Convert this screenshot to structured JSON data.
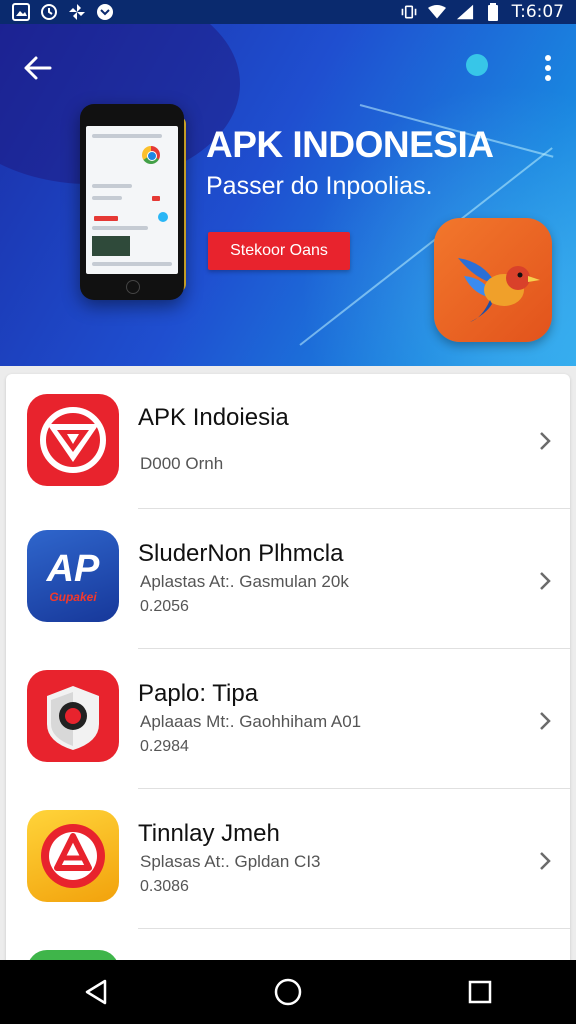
{
  "status_bar": {
    "time": "T:6:07",
    "left_icons": [
      "image-icon",
      "sync-icon",
      "pinwheel-icon",
      "chevron-circle-icon"
    ],
    "right_icons": [
      "vibrate-icon",
      "wifi-icon",
      "signal-icon",
      "battery-icon"
    ]
  },
  "banner": {
    "title": "APK INDONESIA",
    "subtitle": "Passer do Inpoolias.",
    "button_label": "Stekoor Oans",
    "colors": {
      "start": "#1a2fa8",
      "end": "#2aa6ec",
      "button": "#e8232d",
      "app_icon": "#f2772c"
    }
  },
  "apps": [
    {
      "name": "APK Indoiesia",
      "subtitle": "D000 Ornh",
      "meta": "",
      "icon": "red-shield-icon",
      "icon_color": "#e8232d"
    },
    {
      "name": "SluderNon Plhmcla",
      "subtitle": "Aplastas At:. Gasmulan 20k",
      "meta": "0.2056",
      "icon": "ap-logo-icon",
      "icon_color": "#1d4ea8",
      "icon_text": "AP",
      "icon_subtext": "Gupakei"
    },
    {
      "name": "Paplo: Tipa",
      "subtitle": "Aplaaas Mt:. Gaohhiham A01",
      "meta": "0.2984",
      "icon": "camera-shield-icon",
      "icon_color": "#e8232d"
    },
    {
      "name": "Tinnlay Jmeh",
      "subtitle": "Splasas At:. Gpldan CI3",
      "meta": "0.3086",
      "icon": "triangle-a-icon",
      "icon_color": "#f7b512"
    }
  ],
  "nav": {
    "icons": [
      "back-triangle-icon",
      "home-circle-icon",
      "recents-square-icon"
    ]
  }
}
